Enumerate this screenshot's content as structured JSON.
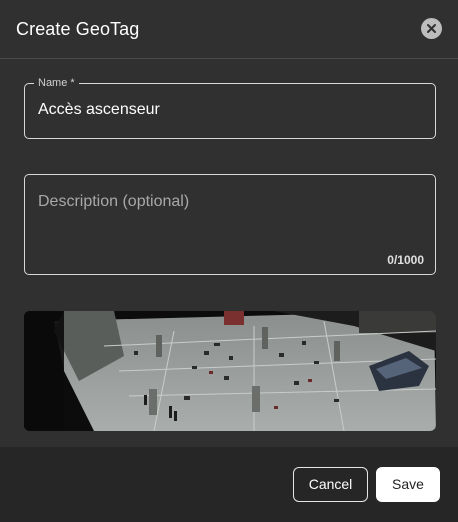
{
  "dialog": {
    "title": "Create GeoTag",
    "close_icon": "close-icon"
  },
  "form": {
    "name": {
      "label": "Name *",
      "value": "Accès ascenseur"
    },
    "description": {
      "placeholder": "Description (optional)",
      "value": "",
      "counter": "0/1000"
    }
  },
  "footer": {
    "cancel_label": "Cancel",
    "save_label": "Save"
  },
  "colors": {
    "background": "#303030",
    "footer": "#262626",
    "field_border": "#d8d8d8",
    "primary_button": "#ffffff"
  }
}
